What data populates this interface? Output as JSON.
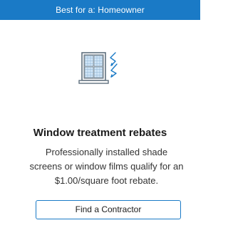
{
  "banner": {
    "text": "Best for a: Homeowner",
    "color": "#1a7ac6"
  },
  "illustration": {
    "icon": "window-treatment-icon"
  },
  "card": {
    "title": "Window treatment rebates",
    "description": "Professionally installed shade screens or window films qualify for an $1.00/square foot rebate.",
    "cta_label": "Find a Contractor"
  }
}
